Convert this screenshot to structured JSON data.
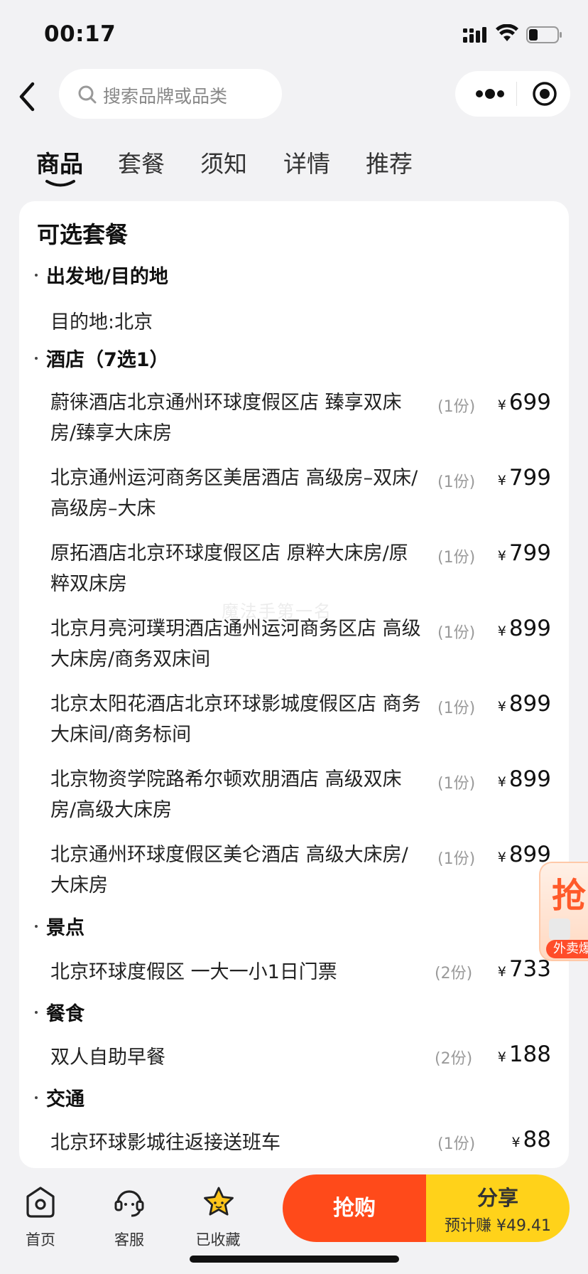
{
  "status_bar": {
    "time": "00:17"
  },
  "search": {
    "placeholder": "搜索品牌或品类"
  },
  "tabs": [
    {
      "label": "商品",
      "active": true
    },
    {
      "label": "套餐",
      "active": false
    },
    {
      "label": "须知",
      "active": false
    },
    {
      "label": "详情",
      "active": false
    },
    {
      "label": "推荐",
      "active": false
    }
  ],
  "card": {
    "title": "可选套餐",
    "departure_section": "出发地/目的地",
    "destination": "目的地:北京",
    "hotel_section": "酒店（7选1）",
    "hotels": [
      {
        "name": "蔚徕酒店北京通州环球度假区店 臻享双床房/臻享大床房",
        "qty": "(1份)",
        "currency": "¥",
        "price": "699"
      },
      {
        "name": "北京通州运河商务区美居酒店 高级房–双床/高级房–大床",
        "qty": "(1份)",
        "currency": "¥",
        "price": "799"
      },
      {
        "name": "原拓酒店北京环球度假区店 原粹大床房/原粹双床房",
        "qty": "(1份)",
        "currency": "¥",
        "price": "799"
      },
      {
        "name": "北京月亮河璞玥酒店通州运河商务区店 高级大床房/商务双床间",
        "qty": "(1份)",
        "currency": "¥",
        "price": "899"
      },
      {
        "name": "北京太阳花酒店北京环球影城度假区店 商务大床间/商务标间",
        "qty": "(1份)",
        "currency": "¥",
        "price": "899"
      },
      {
        "name": "北京物资学院路希尔顿欢朋酒店 高级双床房/高级大床房",
        "qty": "(1份)",
        "currency": "¥",
        "price": "899"
      },
      {
        "name": "北京通州环球度假区美仑酒店 高级大床房/大床房",
        "qty": "(1份)",
        "currency": "¥",
        "price": "899"
      }
    ],
    "scenic_section": "景点",
    "scenic": {
      "name": "北京环球度假区 一大一小1日门票",
      "qty": "(2份)",
      "currency": "¥",
      "price": "733"
    },
    "meal_section": "餐食",
    "meal": {
      "name": "双人自助早餐",
      "qty": "(2份)",
      "currency": "¥",
      "price": "188"
    },
    "transport_section": "交通",
    "transport": {
      "name": "北京环球影城往返接送班车",
      "qty": "(1份)",
      "currency": "¥",
      "price": "88"
    }
  },
  "watermark": "魔法手第一名",
  "float_promo": {
    "big_char": "抢",
    "tag": "外卖爆"
  },
  "bottom_bar": {
    "home_label": "首页",
    "service_label": "客服",
    "favorite_label": "已收藏",
    "buy_label": "抢购",
    "share_label": "分享",
    "share_earn": "预计赚 ¥49.41"
  },
  "colors": {
    "buy": "#ff4a1a",
    "share": "#ffd21a",
    "star": "#ffc51a"
  }
}
